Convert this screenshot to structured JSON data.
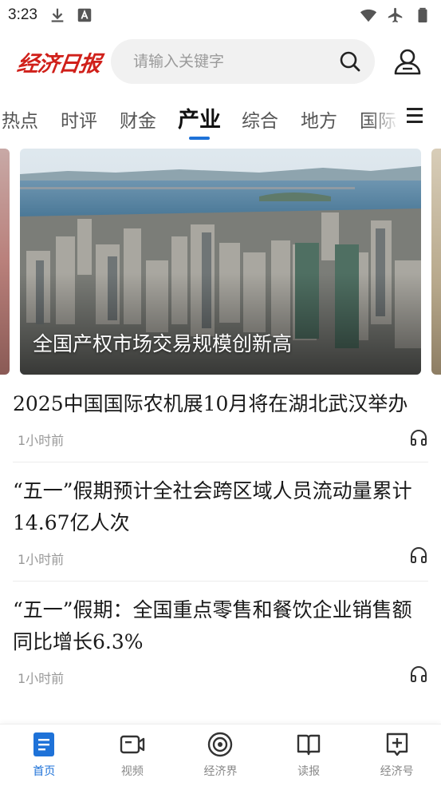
{
  "status_bar": {
    "time": "3:23",
    "left_icons": [
      "download-icon",
      "app-notification-icon"
    ],
    "right_icons": [
      "wifi-icon",
      "airplane-icon",
      "battery-icon"
    ]
  },
  "header": {
    "logo_text": "经济日报",
    "search_placeholder": "请输入关键字",
    "search_value": "",
    "brand_color": "#d0201a"
  },
  "tabs": {
    "items": [
      {
        "label": "热点"
      },
      {
        "label": "时评"
      },
      {
        "label": "财金"
      },
      {
        "label": "产业"
      },
      {
        "label": "综合"
      },
      {
        "label": "地方"
      },
      {
        "label": "国际"
      }
    ],
    "active": "产业",
    "accent_color": "#1e72d8"
  },
  "banner": {
    "caption": "全国产权市场交易规模创新高"
  },
  "news": [
    {
      "title": "2025中国国际农机展10月将在湖北武汉举办",
      "time": "1小时前"
    },
    {
      "title": "“五一”假期预计全社会跨区域人员流动量累计14.67亿人次",
      "time": "1小时前"
    },
    {
      "title": "“五一”假期：全国重点零售和餐饮企业销售额同比增长6.3%",
      "time": "1小时前"
    }
  ],
  "bottom_nav": {
    "items": [
      {
        "label": "首页",
        "icon": "home-document-icon"
      },
      {
        "label": "视频",
        "icon": "video-icon"
      },
      {
        "label": "经济界",
        "icon": "target-icon"
      },
      {
        "label": "读报",
        "icon": "book-icon"
      },
      {
        "label": "经济号",
        "icon": "add-box-icon"
      }
    ],
    "active": "首页"
  }
}
